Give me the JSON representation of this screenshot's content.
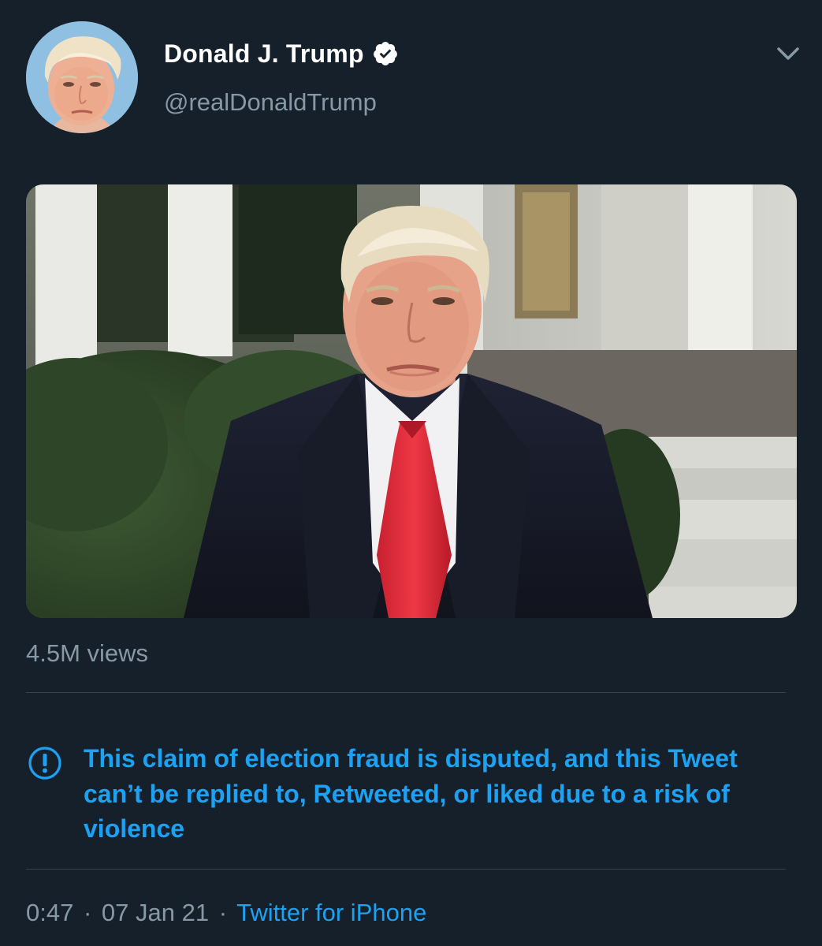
{
  "user": {
    "display_name": "Donald J. Trump",
    "handle": "@realDonaldTrump",
    "verified": true
  },
  "icons": {
    "verified": "verified-badge-icon",
    "menu": "chevron-down-icon",
    "notice": "exclamation-circle-icon"
  },
  "media": {
    "type": "video",
    "views": "4.5M views"
  },
  "notice": {
    "text": "This claim of election fraud is disputed, and this Tweet can’t be replied to, Retweeted, or liked due to a risk of violence"
  },
  "meta": {
    "time": "0:47",
    "separator": "·",
    "date": "07 Jan 21",
    "source": "Twitter for iPhone"
  },
  "colors": {
    "background": "#15202b",
    "primary_text": "#ffffff",
    "secondary_text": "#8899a6",
    "accent": "#1da1f2",
    "divider": "#38444d"
  }
}
